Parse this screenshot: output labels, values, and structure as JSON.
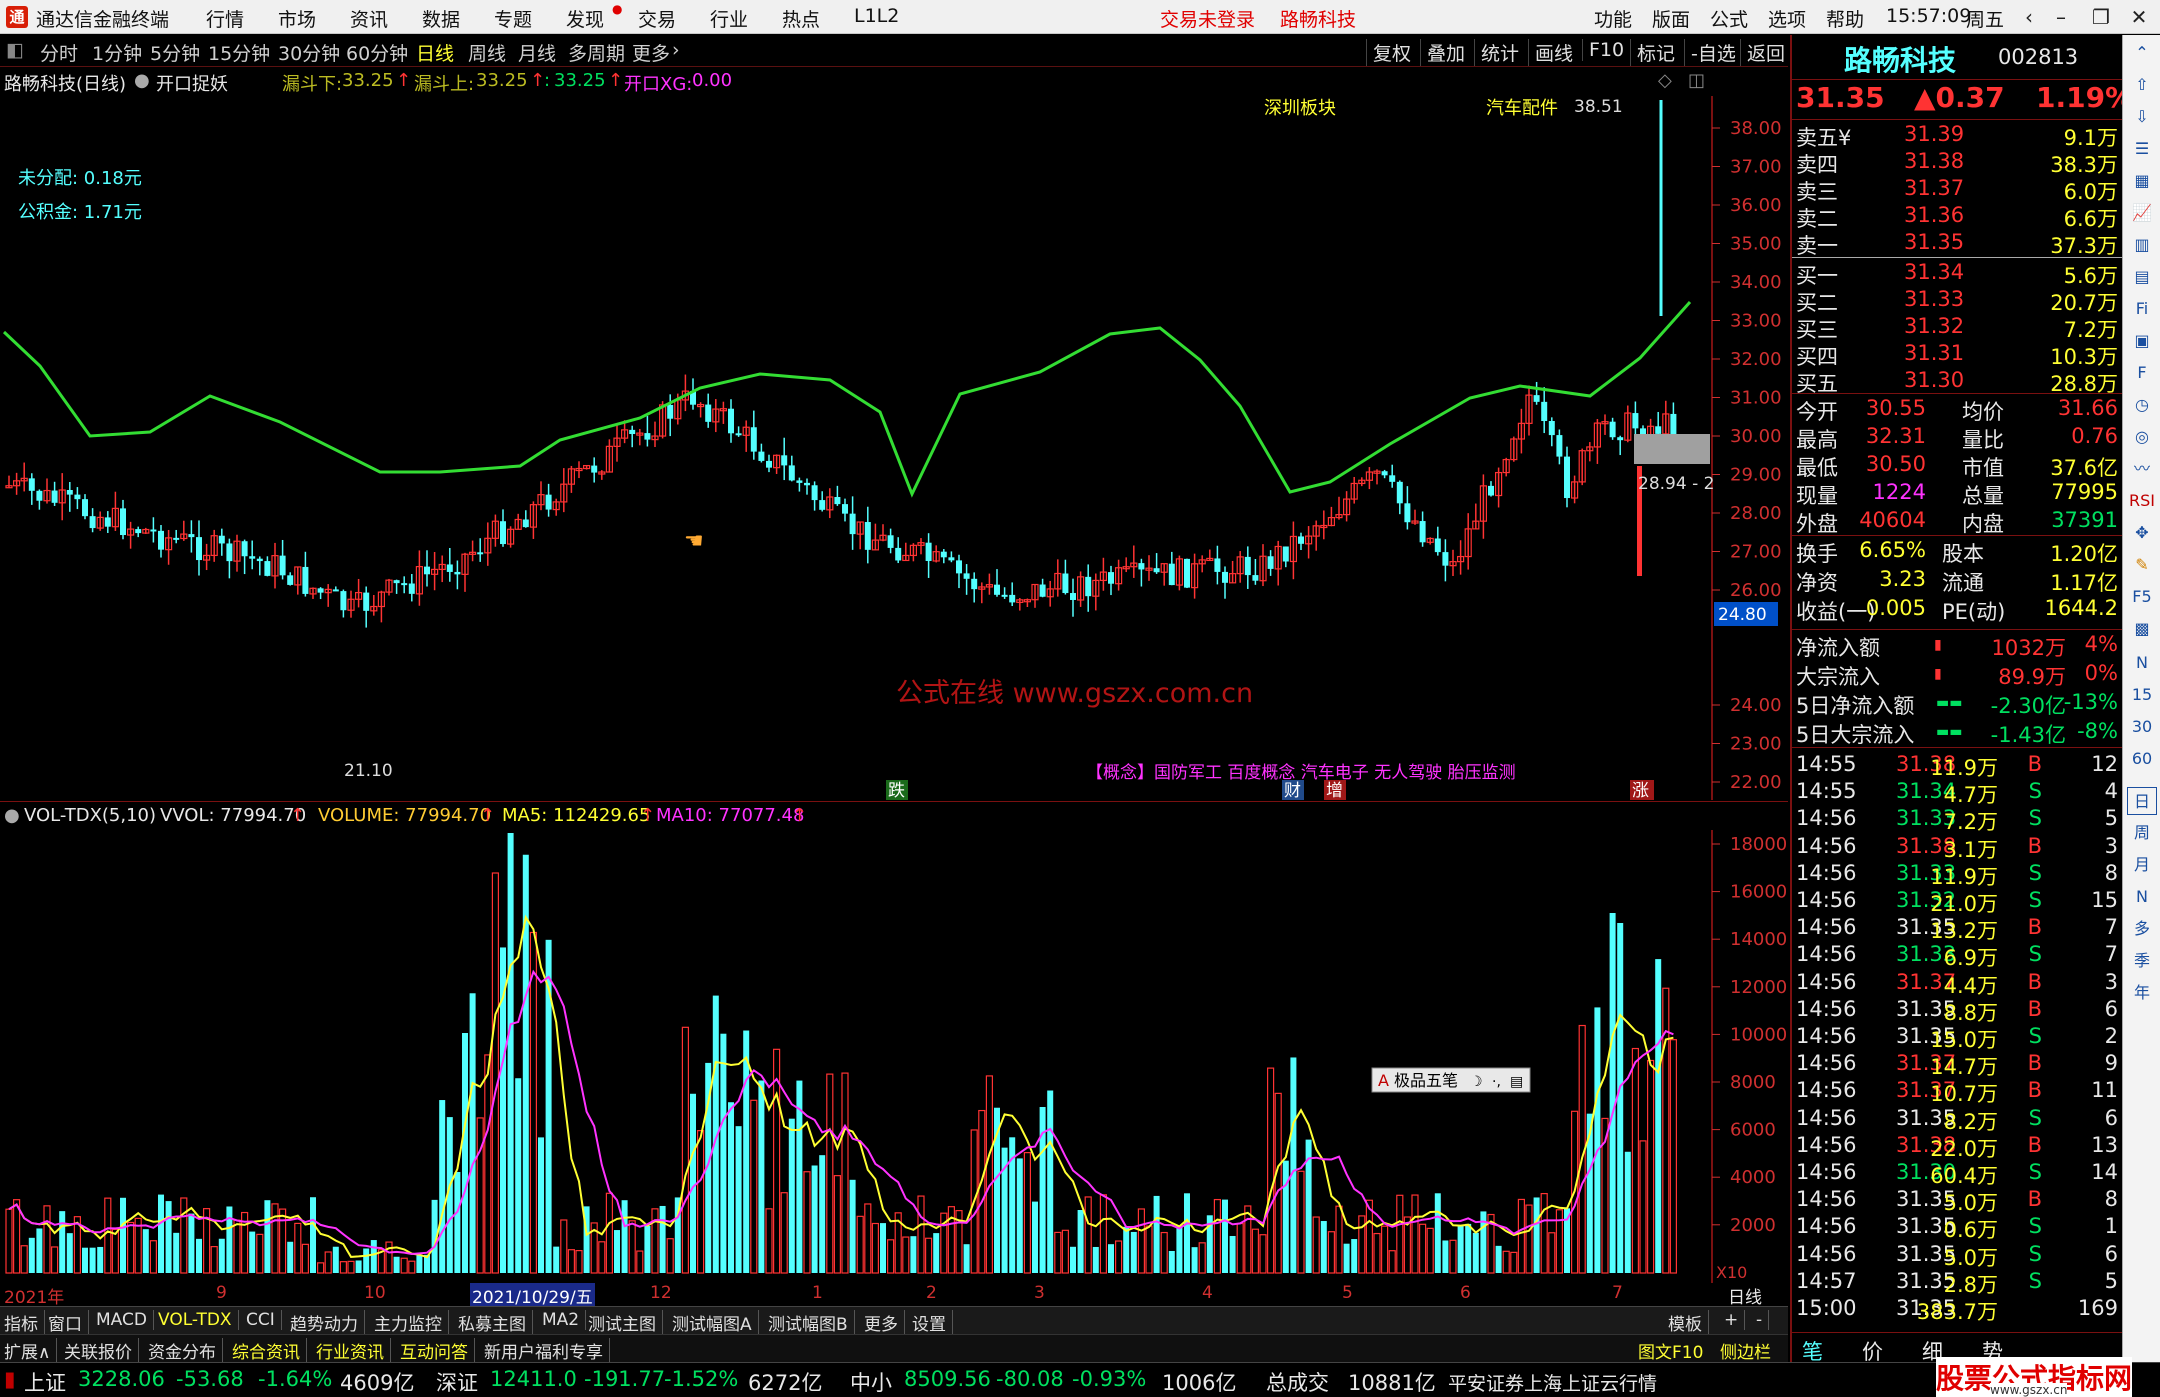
{
  "app": {
    "title": "通达信金融终端",
    "menu": [
      "行情",
      "市场",
      "资讯",
      "数据",
      "专题",
      "发现",
      "交易",
      "行业",
      "热点",
      "L1L2"
    ],
    "login_status": "交易未登录",
    "stock_title": "路畅科技",
    "right_menu": [
      "功能",
      "版面",
      "公式",
      "选项",
      "帮助"
    ],
    "time": "15:57:09",
    "weekday": "周五"
  },
  "periods": [
    "分时",
    "1分钟",
    "5分钟",
    "15分钟",
    "30分钟",
    "60分钟",
    "日线",
    "周线",
    "月线",
    "多周期",
    "更多"
  ],
  "active_period": "日线",
  "tools": [
    "复权",
    "叠加",
    "统计",
    "画线",
    "F10",
    "标记",
    "-自选",
    "返回"
  ],
  "chart_info": {
    "name": "路畅科技(日线)",
    "indicator": "开口捉妖",
    "f1_label": "漏斗下:",
    "f1_val": "33.25",
    "f2_label": "漏斗上:",
    "f2_val": "33.25",
    "f3_label": ":",
    "f3_val": "33.25",
    "f4_label": "开口XG:",
    "f4_val": "0.00"
  },
  "annotations": {
    "undistributed": "未分配: 0.18元",
    "reserve": "公积金: 1.71元",
    "sector1": "深圳板块",
    "sector2": "汽车配件",
    "high": "38.51",
    "low": "21.10",
    "box_label": "28.94 - 2",
    "current_tag": "24.80",
    "watermark": "公式在线   www.gszx.com.cn",
    "concepts": "【概念】国防军工 百度概念 汽车电子 无人驾驶 胎压监测",
    "mark_die": "跌",
    "mark_cai": "财",
    "mark_zeng": "增",
    "mark_zhang": "涨",
    "widget_label": "极品五笔"
  },
  "price_axis": [
    "38.00",
    "37.00",
    "36.00",
    "35.00",
    "34.00",
    "33.00",
    "32.00",
    "31.00",
    "30.00",
    "29.00",
    "28.00",
    "27.00",
    "26.00",
    "24.00",
    "23.00",
    "22.00"
  ],
  "vol_info": {
    "name": "VOL-TDX(5,10)",
    "vvol": "VVOL: 77994.70",
    "volume": "VOLUME: 77994.70",
    "ma5": "MA5: 112429.65",
    "ma10": "MA10: 77077.48"
  },
  "vol_axis": [
    "18000",
    "16000",
    "14000",
    "12000",
    "10000",
    "8000",
    "6000",
    "4000",
    "2000"
  ],
  "vol_unit": "X10",
  "x_axis": [
    "2021年",
    "9",
    "10",
    "2021/10/29/五",
    "12",
    "1",
    "2",
    "3",
    "4",
    "5",
    "6",
    "7",
    "日线"
  ],
  "tabs": [
    "指标",
    "窗口",
    "MACD",
    "VOL-TDX",
    "CCI",
    "趋势动力",
    "主力监控",
    "私募主图",
    "MA2",
    "测试主图",
    "测试幅图A",
    "测试幅图B",
    "更多",
    "设置"
  ],
  "tabs_right": [
    "模板",
    "+",
    "-"
  ],
  "info_tabs": [
    "扩展∧",
    "关联报价",
    "资金分布",
    "综合资讯",
    "行业资讯",
    "互动问答",
    "新用户福利专享"
  ],
  "info_right": [
    "图文F10",
    "侧边栏《"
  ],
  "quote": {
    "name": "路畅科技",
    "code": "002813",
    "price": "31.35",
    "change": "▲0.37",
    "pct": "1.19%",
    "asks": [
      [
        "卖五¥",
        "31.39",
        "9.1万"
      ],
      [
        "卖四",
        "31.38",
        "38.3万"
      ],
      [
        "卖三",
        "31.37",
        "6.0万"
      ],
      [
        "卖二",
        "31.36",
        "6.6万"
      ],
      [
        "卖一",
        "31.35",
        "37.3万"
      ]
    ],
    "bids": [
      [
        "买一",
        "31.34",
        "5.6万"
      ],
      [
        "买二",
        "31.33",
        "20.7万"
      ],
      [
        "买三",
        "31.32",
        "7.2万"
      ],
      [
        "买四",
        "31.31",
        "10.3万"
      ],
      [
        "买五",
        "31.30",
        "28.8万"
      ]
    ],
    "stats": [
      [
        "今开",
        "30.55",
        "均价",
        "31.66"
      ],
      [
        "最高",
        "32.31",
        "量比",
        "0.76"
      ],
      [
        "最低",
        "30.50",
        "市值",
        "37.6亿"
      ],
      [
        "现量",
        "1224",
        "总量",
        "77995"
      ],
      [
        "外盘",
        "40604",
        "内盘",
        "37391"
      ]
    ],
    "fin": [
      [
        "换手",
        "6.65%",
        "股本",
        "1.20亿"
      ],
      [
        "净资",
        "3.23",
        "流通",
        "1.17亿"
      ],
      [
        "收益(一)",
        "0.005",
        "PE(动)",
        "1644.2"
      ]
    ],
    "flows": [
      [
        "净流入额",
        "1032万",
        "4%"
      ],
      [
        "大宗流入",
        "89.9万",
        "0%"
      ],
      [
        "5日净流入额",
        "-2.30亿",
        "-13%"
      ],
      [
        "5日大宗流入",
        "-1.43亿",
        "-8%"
      ]
    ],
    "ticks": [
      [
        "14:55",
        "31.38",
        "11.9万",
        "B",
        "12"
      ],
      [
        "14:55",
        "31.34",
        "4.7万",
        "S",
        "4"
      ],
      [
        "14:56",
        "31.33",
        "7.2万",
        "S",
        "5"
      ],
      [
        "14:56",
        "31.38",
        "3.1万",
        "B",
        "3"
      ],
      [
        "14:56",
        "31.33",
        "11.9万",
        "S",
        "8"
      ],
      [
        "14:56",
        "31.32",
        "21.0万",
        "S",
        "15"
      ],
      [
        "14:56",
        "31.35",
        "13.2万",
        "B",
        "7"
      ],
      [
        "14:56",
        "31.33",
        "6.9万",
        "S",
        "7"
      ],
      [
        "14:56",
        "31.37",
        "4.4万",
        "B",
        "3"
      ],
      [
        "14:56",
        "31.35",
        "8.8万",
        "B",
        "6"
      ],
      [
        "14:56",
        "31.35",
        "15.0万",
        "S",
        "2"
      ],
      [
        "14:56",
        "31.37",
        "14.7万",
        "B",
        "9"
      ],
      [
        "14:56",
        "31.37",
        "10.7万",
        "B",
        "11"
      ],
      [
        "14:56",
        "31.35",
        "8.2万",
        "S",
        "6"
      ],
      [
        "14:56",
        "31.38",
        "22.0万",
        "B",
        "13"
      ],
      [
        "14:56",
        "31.30",
        "60.4万",
        "S",
        "14"
      ],
      [
        "14:56",
        "31.35",
        "5.0万",
        "B",
        "8"
      ],
      [
        "14:56",
        "31.35",
        "0.6万",
        "S",
        "1"
      ],
      [
        "14:56",
        "31.35",
        "5.0万",
        "S",
        "6"
      ],
      [
        "14:57",
        "31.35",
        "2.8万",
        "S",
        "5"
      ],
      [
        "15:00",
        "31.35",
        "383.7万",
        "",
        "169"
      ]
    ],
    "bottom_tabs": [
      "笔",
      "价",
      "细",
      "势"
    ]
  },
  "sidebar": [
    "日",
    "周",
    "月",
    "N",
    "多",
    "季",
    "年",
    "15",
    "30",
    "60",
    "RSI",
    "F10",
    "F5"
  ],
  "status": {
    "sh_name": "上证",
    "sh_val": "3228.06",
    "sh_chg": "-53.68",
    "sh_pct": "-1.64%",
    "sh_amt": "4609亿",
    "sz_name": "深证",
    "sz_val": "12411.0",
    "sz_chg": "-191.77",
    "sz_pct": "-1.52%",
    "sz_amt": "6272亿",
    "zx_name": "中小",
    "zx_val": "8509.56",
    "zx_chg": "-80.08",
    "zx_pct": "-0.93%",
    "zx_amt": "1006亿",
    "total_label": "总成交",
    "total_val": "10881亿",
    "broker": "平安证券上海上证云行情",
    "brand": "股票公式指标网",
    "brand_url": "www.gszx.cn"
  },
  "colors": {
    "up": "#ff3333",
    "down": "#54ffff",
    "ma_line": "#33dd33",
    "ma5": "#ffff33",
    "ma10": "#ff33ff"
  }
}
